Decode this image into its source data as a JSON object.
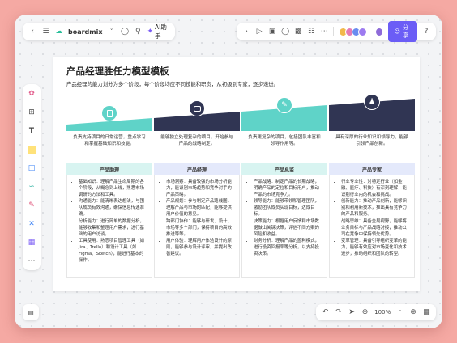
{
  "topbar": {
    "app_name": "boardmix",
    "ai_label": "AI助手",
    "share_label": "分享"
  },
  "board": {
    "title": "产品经理胜任力模型模板",
    "subtitle": "产品经理的能力划分为多个阶段，每个阶段均应不同技能和职责，从初级到专家，逐步递进。"
  },
  "columns": [
    {
      "id": "assistant",
      "color": "#5fd3c8",
      "desc": "负责支持项目的日常运营，重点学习和掌握基础知识和技能。",
      "head": "产品助理",
      "head_bg": "#d8f4f1",
      "items": [
        "基础知识：理解产品生命周期的各个阶段，从概念到上线，熟悉市场调研的方法和工具。",
        "沟通能力：能清晰表达想法，与团队成员有效沟通，确保信息传递准确。",
        "分析能力：进行简单的数据分析，能够收集和整理用户需求，进行基础的用户访谈。",
        "工具使用：熟悉项目管理工具（如Jira、Trello）和设计工具（如Figma、Sketch），能进行基本的操作。"
      ]
    },
    {
      "id": "manager",
      "color": "#303553",
      "desc": "能够独立处理复杂的项目，开始参与产品的战略制定。",
      "head": "产品经理",
      "head_bg": "#e4e9fb",
      "items": [
        "市场洞察：具备较强的市场分析能力，能识别市场趋势和竞争对手的产品策略。",
        "产品规划：参与制定产品路线图，理解产品与市场的匹配，能够提供用户价值的意见。",
        "跨部门协作：能够与研发、设计、市场等多个部门，保持项目的高效推进等等。",
        "用户体验：理解用户体验设计的原则，能够参与设计评审，并提出改善建议。"
      ]
    },
    {
      "id": "senior",
      "color": "#5fd3c8",
      "desc": "负责更复杂的项目，包括团队丰富和领导作用等。",
      "head": "产品总监",
      "head_bg": "#d8f4f1",
      "items": [
        "产品战略：制定产品的长期战略，明确产品的定位和目标用户，推动产品的市场竞争力。",
        "领导能力：能够带领和管理团队，激励团队成员实现目标，达成目标。",
        "决策能力：根据用户反馈和市场数据做出关键决策，评估不同方案的风险和收益。",
        "财务分析：理解产品的盈利模式，进行投资回报率等分析，以支持投资决策。"
      ]
    },
    {
      "id": "expert",
      "color": "#303553",
      "desc": "具有深厚的行业知识和领导力，能够引领产品创新。",
      "head": "产品专家",
      "head_bg": "#e4e9fb",
      "items": [
        "行业专业性：对特定行业（如金融、医疗、科技）有深刻理解，能识别行业内的机会和挑战。",
        "创新能力：推动产品创新，能够识别和利用新技术，推出具有竞争力的产品和服务。",
        "战略思维：具备全局视野，能够将业务目标与产品战略对接，推动公司在竞争中保持领先优势。",
        "变革管理：具备引导组织变革的能力，能够有效应对市场变化和技术进步，推动组织和团队的转型。"
      ]
    }
  ],
  "bottombar": {
    "zoom": "100%"
  }
}
